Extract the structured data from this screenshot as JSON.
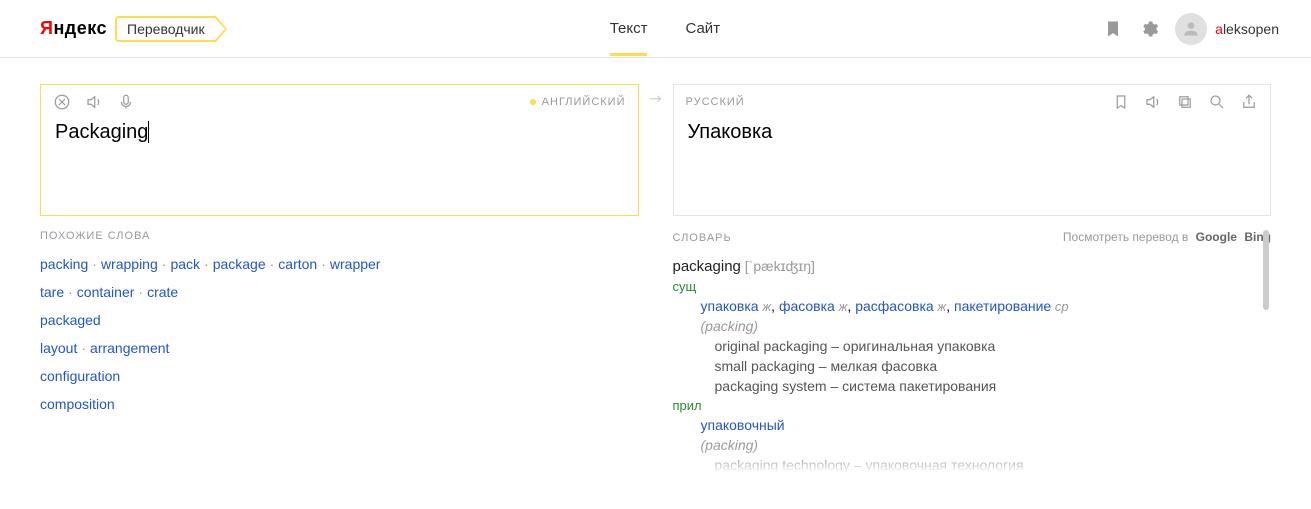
{
  "header": {
    "brand_prefix": "Я",
    "brand_rest": "ндекс",
    "service": "Переводчик",
    "tabs": [
      "Текст",
      "Сайт"
    ],
    "active_tab": 0,
    "user_first": "a",
    "user_rest": "leksopen"
  },
  "source": {
    "lang_label": "АНГЛИЙСКИЙ",
    "text": "Packaging"
  },
  "target": {
    "lang_label": "РУССКИЙ",
    "text": "Упаковка"
  },
  "similar": {
    "title": "ПОХОЖИЕ СЛОВА",
    "rows": [
      [
        "packing",
        "wrapping",
        "pack",
        "package",
        "carton",
        "wrapper"
      ],
      [
        "tare",
        "container",
        "crate"
      ],
      [
        "packaged"
      ],
      [
        "layout",
        "arrangement"
      ],
      [
        "configuration"
      ],
      [
        "composition"
      ]
    ]
  },
  "dict": {
    "title": "СЛОВАРЬ",
    "ext_label": "Посмотреть перевод в",
    "ext_links": [
      "Google",
      "Bing"
    ],
    "word": "packaging",
    "ipa": "[ˈpækɪʤɪŋ]",
    "entries": [
      {
        "pos": "сущ",
        "senses": [
          {
            "terms": [
              {
                "w": "упаковка",
                "g": "ж"
              },
              {
                "w": "фасовка",
                "g": "ж"
              },
              {
                "w": "расфасовка",
                "g": "ж"
              },
              {
                "w": "пакетирование",
                "g": "ср"
              }
            ],
            "paren": "(packing)",
            "examples": [
              "original packaging – оригинальная упаковка",
              "small packaging – мелкая фасовка",
              "packaging system – система пакетирования"
            ]
          }
        ]
      },
      {
        "pos": "прил",
        "senses": [
          {
            "terms": [
              {
                "w": "упаковочный",
                "g": ""
              }
            ],
            "paren": "(packing)",
            "examples": [
              "packaging technology – упаковочная технология"
            ]
          }
        ]
      }
    ]
  }
}
